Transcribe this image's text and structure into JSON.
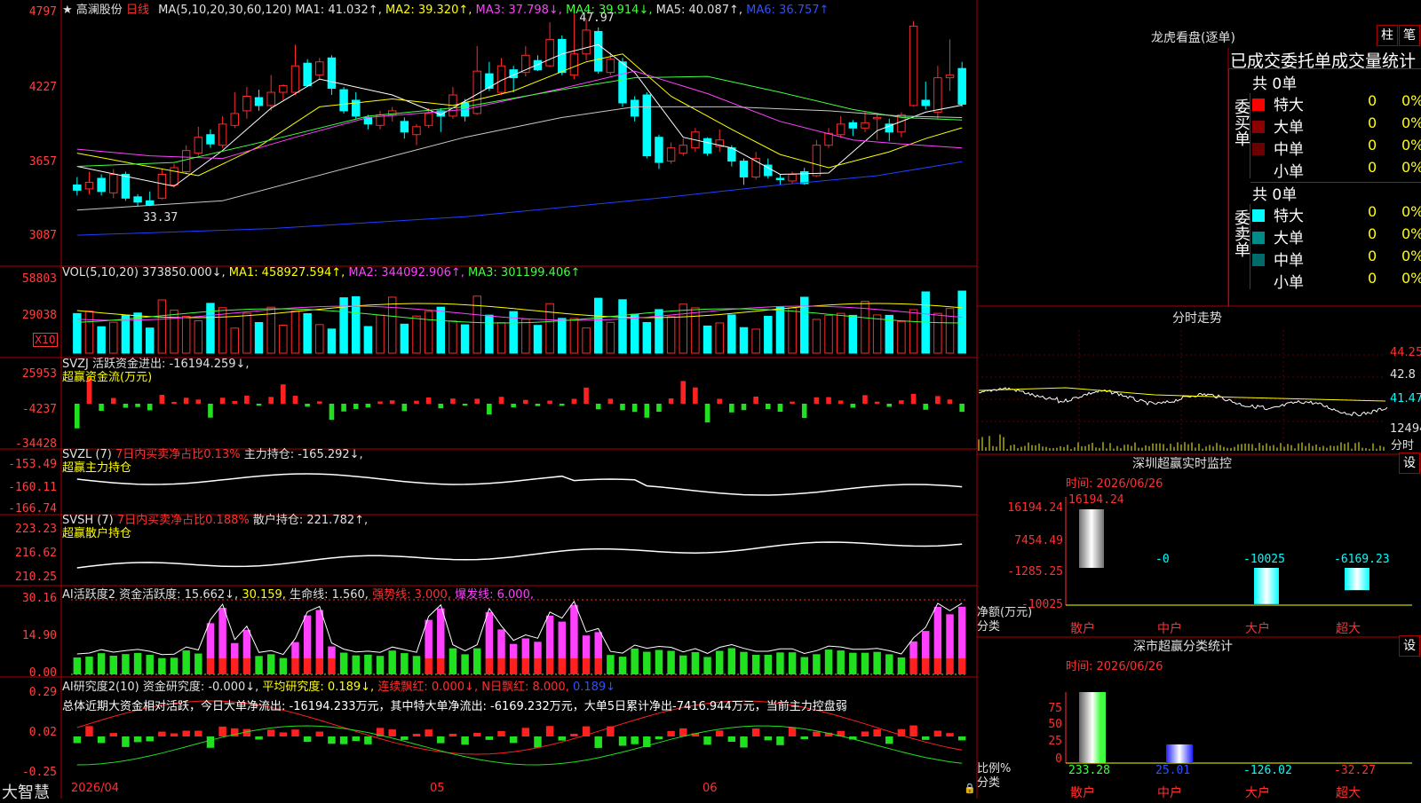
{
  "stock": {
    "star": "★",
    "name": "高澜股份",
    "period": "日线"
  },
  "ma_legend": [
    {
      "text": "MA(5,10,20,30,60,120)",
      "color": "#e0e0e0"
    },
    {
      "text": "MA1: 41.032↑,",
      "color": "#e0e0e0"
    },
    {
      "text": "MA2: 39.320↑,",
      "color": "#ffff00"
    },
    {
      "text": "MA3: 37.798↓,",
      "color": "#ff40ff"
    },
    {
      "text": "MA4: 39.914↓,",
      "color": "#40ff40"
    },
    {
      "text": "MA5: 40.087↑,",
      "color": "#e0e0e0"
    },
    {
      "text": "MA6: 36.757↑",
      "color": "#3050ff"
    }
  ],
  "price_axis": {
    "ticks": [
      "4797",
      "4227",
      "3657",
      "3087"
    ],
    "high_label": "47.97",
    "low_label": "33.37"
  },
  "vol": {
    "legend": [
      {
        "text": "VOL(5,10,20)",
        "color": "#e0e0e0"
      },
      {
        "text": "373850.000↓,",
        "color": "#e0e0e0"
      },
      {
        "text": "MA1: 458927.594↑,",
        "color": "#ffff00"
      },
      {
        "text": "MA2: 344092.906↑,",
        "color": "#ff40ff"
      },
      {
        "text": "MA3: 301199.406↑",
        "color": "#40ff40"
      }
    ],
    "ticks": [
      "58803",
      "29038"
    ],
    "unit": "X10"
  },
  "svzj": {
    "line1": "SVZJ  活跃资金进出: -16194.259↓,",
    "line2": "超赢资金流(万元)",
    "ticks": [
      "25953",
      "-4237",
      "-34428"
    ]
  },
  "svzl": {
    "a": "SVZL (7)",
    "b": "7日内买卖净占比0.13%",
    "c": "主力持仓: -165.292↓,",
    "line2": "超赢主力持仓",
    "ticks": [
      "-153.49",
      "-160.11",
      "-166.74"
    ]
  },
  "svsh": {
    "a": "SVSH (7)",
    "b": "7日内买卖净占比0.188%",
    "c": "散户持仓: 221.782↑,",
    "line2": "超赢散户持仓",
    "ticks": [
      "223.23",
      "216.62",
      "210.25"
    ]
  },
  "ai_active": {
    "a": "AI活跃度2",
    "b": "资金活跃度: 15.662↓,",
    "c": "30.159,",
    "d": "生命线: 1.560,",
    "e": "强势线: 3.000,",
    "f": "爆发线: 6.000,",
    "ticks": [
      "30.16",
      "14.90",
      "0.00"
    ]
  },
  "ai_research": {
    "a": "AI研究度2(10)",
    "b": "资金研究度: -0.000↓,",
    "c": "平均研究度: 0.189↓,",
    "d": "连续飘红: 0.000↓,",
    "e": "N日飘红: 8.000,",
    "f": "0.189↓",
    "summary": "总体近期大资金相对活跃，今日大单净流出: -16194.233万元，其中特大单净流出: -6169.232万元，大单5日累计净出-7416.944万元，当前主力控盘弱",
    "ticks": [
      "0.29",
      "0.02",
      "-0.25"
    ]
  },
  "date_axis": [
    "2026/04",
    "05",
    "06"
  ],
  "footer_brand": "大智慧",
  "right_panel": {
    "dragon_title": "龙虎看盘(逐单)",
    "btn_bar": "柱",
    "btn_pen": "笔",
    "tabs_title": "已成交委托单成交量统计",
    "buy": {
      "side_label": "委买单",
      "total": "共 0单",
      "rows": [
        {
          "name": "特大",
          "val": "0",
          "pct": "0%",
          "color": "#ff0000"
        },
        {
          "name": "大单",
          "val": "0",
          "pct": "0%",
          "color": "#8b0000"
        },
        {
          "name": "中单",
          "val": "0",
          "pct": "0%",
          "color": "#6b0000"
        },
        {
          "name": "小单",
          "val": "0",
          "pct": "0%",
          "color": ""
        }
      ]
    },
    "sell": {
      "side_label": "委卖单",
      "total": "共 0单",
      "rows": [
        {
          "name": "特大",
          "val": "0",
          "pct": "0%",
          "color": "#00ffff"
        },
        {
          "name": "大单",
          "val": "0",
          "pct": "0%",
          "color": "#008b8b"
        },
        {
          "name": "中单",
          "val": "0",
          "pct": "0%",
          "color": "#006b6b"
        },
        {
          "name": "小单",
          "val": "0",
          "pct": "0%",
          "color": ""
        }
      ]
    },
    "intraday_title": "分时走势",
    "intraday_ticks": [
      "44.25",
      "42.8",
      "41.47",
      "12494"
    ],
    "intraday_unit": "分时",
    "monitor": {
      "title": "深圳超赢实时监控",
      "btn": "设",
      "time": "时间: 2026/06/26",
      "ylabel": "净额(万元)",
      "xlabel": "分类",
      "ticks": [
        "16194.24",
        "7454.49",
        "-1285.25",
        "-10025"
      ],
      "categories": [
        "散户",
        "中户",
        "大户",
        "超大"
      ],
      "values": [
        "16194.24",
        "-0",
        "-10025",
        "-6169.23"
      ]
    },
    "classify": {
      "title": "深市超赢分类统计",
      "btn": "设",
      "time": "时间: 2026/06/26",
      "ylabel": "比例%",
      "xlabel": "分类",
      "ticks": [
        "75",
        "50",
        "25",
        "0"
      ],
      "categories": [
        "散户",
        "中户",
        "大户",
        "超大"
      ],
      "values": [
        "233.28",
        "25.01",
        "-126.02",
        "-32.27"
      ]
    }
  },
  "chart_data": {
    "type": "candlestick",
    "title": "高澜股份 日线",
    "price_range": [
      30.87,
      47.97
    ],
    "candles": [
      [
        35.0,
        34.6,
        35.6,
        34.2
      ],
      [
        34.7,
        35.2,
        36.0,
        34.3
      ],
      [
        35.5,
        34.5,
        35.8,
        34.2
      ],
      [
        34.4,
        35.8,
        36.2,
        34.0
      ],
      [
        35.8,
        34.0,
        36.0,
        33.8
      ],
      [
        34.1,
        33.7,
        34.3,
        33.4
      ],
      [
        33.8,
        33.5,
        34.5,
        33.4
      ],
      [
        34.0,
        35.8,
        36.2,
        33.9
      ],
      [
        35.0,
        36.3,
        36.6,
        34.8
      ],
      [
        36.0,
        37.6,
        38.0,
        35.8
      ],
      [
        37.4,
        38.6,
        39.4,
        37.2
      ],
      [
        38.8,
        38.1,
        39.2,
        37.8
      ],
      [
        38.0,
        39.6,
        40.2,
        37.8
      ],
      [
        39.5,
        40.4,
        42.0,
        39.3
      ],
      [
        40.6,
        41.7,
        42.4,
        40.0
      ],
      [
        41.6,
        41.0,
        42.2,
        40.6
      ],
      [
        41.0,
        42.0,
        43.3,
        40.6
      ],
      [
        42.0,
        42.5,
        42.6,
        41.4
      ],
      [
        42.0,
        44.0,
        45.6,
        41.8
      ],
      [
        44.2,
        42.5,
        44.5,
        42.4
      ],
      [
        43.3,
        44.3,
        44.6,
        43.0
      ],
      [
        44.6,
        42.3,
        44.8,
        41.8
      ],
      [
        42.2,
        40.6,
        42.4,
        40.4
      ],
      [
        41.4,
        40.2,
        42.0,
        40.0
      ],
      [
        40.1,
        39.6,
        40.3,
        39.2
      ],
      [
        39.5,
        40.3,
        40.6,
        39.2
      ],
      [
        40.3,
        40.6,
        40.9,
        39.8
      ],
      [
        39.8,
        39.0,
        40.1,
        38.5
      ],
      [
        38.8,
        39.4,
        39.6,
        38.0
      ],
      [
        39.5,
        40.4,
        40.8,
        39.3
      ],
      [
        40.6,
        40.2,
        40.8,
        39.0
      ],
      [
        40.2,
        41.8,
        42.4,
        40.0
      ],
      [
        41.2,
        40.2,
        41.5,
        39.8
      ],
      [
        40.4,
        43.6,
        45.5,
        40.3
      ],
      [
        43.4,
        42.3,
        44.3,
        42.1
      ],
      [
        42.0,
        44.0,
        44.6,
        41.8
      ],
      [
        43.7,
        43.1,
        44.0,
        42.0
      ],
      [
        43.5,
        44.8,
        45.5,
        43.2
      ],
      [
        44.4,
        43.7,
        44.8,
        43.6
      ],
      [
        44.0,
        46.0,
        47.3,
        43.9
      ],
      [
        46.0,
        43.5,
        46.3,
        43.3
      ],
      [
        43.3,
        44.9,
        47.97,
        43.0
      ],
      [
        44.9,
        46.7,
        47.5,
        44.4
      ],
      [
        46.6,
        43.6,
        46.9,
        43.4
      ],
      [
        43.5,
        44.5,
        45.0,
        43.3
      ],
      [
        44.3,
        41.2,
        44.6,
        40.9
      ],
      [
        41.4,
        40.2,
        41.7,
        39.8
      ],
      [
        41.8,
        37.2,
        42.0,
        37.0
      ],
      [
        38.6,
        36.7,
        38.8,
        36.2
      ],
      [
        36.8,
        37.8,
        38.2,
        36.6
      ],
      [
        37.4,
        38.0,
        38.5,
        37.2
      ],
      [
        37.8,
        39.0,
        39.3,
        37.5
      ],
      [
        38.5,
        37.4,
        38.6,
        37.2
      ],
      [
        37.9,
        38.4,
        39.2,
        37.5
      ],
      [
        37.8,
        36.8,
        38.0,
        36.4
      ],
      [
        36.8,
        35.6,
        37.0,
        35.0
      ],
      [
        35.6,
        37.0,
        37.5,
        35.4
      ],
      [
        36.5,
        35.7,
        37.0,
        35.5
      ],
      [
        35.5,
        35.4,
        35.8,
        35.0
      ],
      [
        35.3,
        35.8,
        36.0,
        35.1
      ],
      [
        36.0,
        35.1,
        36.3,
        35.0
      ],
      [
        35.7,
        38.0,
        38.4,
        35.6
      ],
      [
        38.0,
        38.9,
        39.3,
        37.8
      ],
      [
        38.8,
        39.6,
        40.2,
        38.6
      ],
      [
        39.7,
        39.3,
        39.9,
        38.7
      ],
      [
        39.3,
        39.7,
        40.5,
        39.0
      ],
      [
        40.0,
        40.1,
        40.3,
        38.4
      ],
      [
        39.6,
        39.0,
        40.0,
        38.3
      ],
      [
        39.0,
        40.3,
        40.5,
        38.6
      ],
      [
        41.0,
        47.0,
        47.4,
        40.9
      ],
      [
        41.4,
        41.0,
        42.8,
        40.7
      ],
      [
        40.5,
        43.1,
        44.0,
        40.0
      ],
      [
        43.1,
        43.3,
        46.0,
        42.1
      ],
      [
        43.8,
        41.1,
        44.3,
        40.9
      ]
    ],
    "ma": {
      "MA1": [
        [
          0,
          36.4
        ],
        [
          8,
          34.9
        ],
        [
          12,
          37.6
        ],
        [
          16,
          40.8
        ],
        [
          20,
          43.0
        ],
        [
          26,
          41.8
        ],
        [
          30,
          40.3
        ],
        [
          35,
          42.9
        ],
        [
          40,
          44.9
        ],
        [
          43,
          45.6
        ],
        [
          46,
          43.5
        ],
        [
          50,
          38.6
        ],
        [
          54,
          37.8
        ],
        [
          58,
          35.8
        ],
        [
          62,
          35.9
        ],
        [
          66,
          39.1
        ],
        [
          70,
          40.5
        ],
        [
          73,
          41.03
        ]
      ],
      "MA2": [
        [
          0,
          37.4
        ],
        [
          10,
          35.7
        ],
        [
          15,
          37.9
        ],
        [
          20,
          40.9
        ],
        [
          26,
          41.5
        ],
        [
          31,
          41.0
        ],
        [
          36,
          42.1
        ],
        [
          42,
          44.3
        ],
        [
          45,
          44.9
        ],
        [
          49,
          41.7
        ],
        [
          54,
          39.2
        ],
        [
          58,
          37.3
        ],
        [
          62,
          36.3
        ],
        [
          67,
          37.5
        ],
        [
          70,
          38.5
        ],
        [
          73,
          39.32
        ]
      ],
      "MA3": [
        [
          0,
          37.7
        ],
        [
          6,
          37.2
        ],
        [
          12,
          37.0
        ],
        [
          18,
          38.6
        ],
        [
          24,
          40.1
        ],
        [
          32,
          40.7
        ],
        [
          40,
          42.3
        ],
        [
          46,
          43.6
        ],
        [
          52,
          41.9
        ],
        [
          58,
          39.8
        ],
        [
          64,
          38.4
        ],
        [
          68,
          38.1
        ],
        [
          73,
          37.8
        ]
      ],
      "MA4": [
        [
          0,
          36.4
        ],
        [
          8,
          36.7
        ],
        [
          16,
          38.4
        ],
        [
          24,
          40.2
        ],
        [
          32,
          40.9
        ],
        [
          40,
          42.2
        ],
        [
          46,
          43.1
        ],
        [
          52,
          43.2
        ],
        [
          58,
          42.0
        ],
        [
          64,
          40.7
        ],
        [
          68,
          40.1
        ],
        [
          73,
          39.91
        ]
      ],
      "MA5": [
        [
          0,
          33.1
        ],
        [
          12,
          33.8
        ],
        [
          24,
          36.7
        ],
        [
          32,
          38.6
        ],
        [
          40,
          40.1
        ],
        [
          46,
          40.9
        ],
        [
          54,
          40.9
        ],
        [
          62,
          40.6
        ],
        [
          68,
          40.2
        ],
        [
          73,
          40.09
        ]
      ],
      "MA6": [
        [
          0,
          31.2
        ],
        [
          16,
          31.7
        ],
        [
          32,
          32.6
        ],
        [
          48,
          34.0
        ],
        [
          58,
          35.0
        ],
        [
          66,
          35.7
        ],
        [
          73,
          36.76
        ]
      ]
    }
  }
}
